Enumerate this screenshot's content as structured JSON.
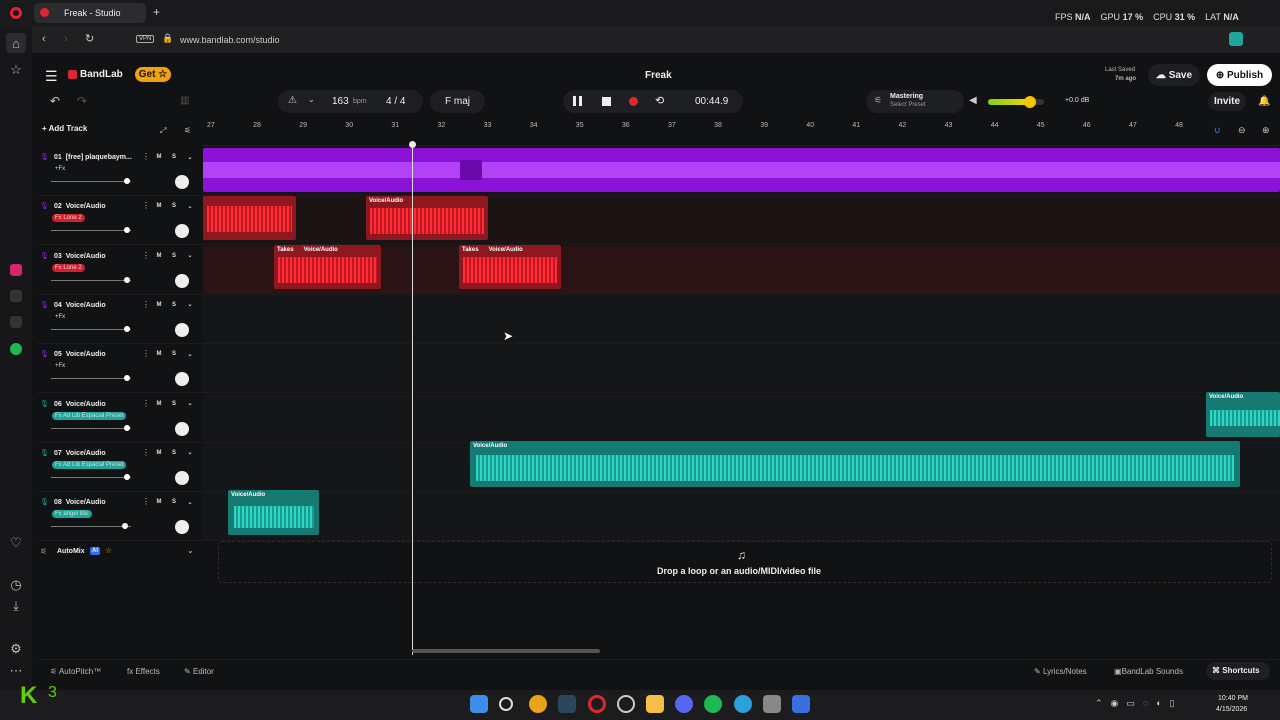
{
  "browser": {
    "tab_title": "Freak - Studio",
    "new_tab": "+",
    "url": "www.bandlab.com/studio",
    "vpn": "VPN",
    "stats": {
      "fps_label": "FPS",
      "fps": "N/A",
      "gpu_label": "GPU",
      "gpu": "17 %",
      "cpu_label": "CPU",
      "cpu": "31 %",
      "lat_label": "LAT",
      "lat": "N/A"
    }
  },
  "header": {
    "brand": "BandLab",
    "get_label": "Get",
    "project_title": "Freak",
    "last_saved_label": "Last Saved",
    "last_saved_time": "7m ago",
    "save_label": "Save",
    "publish_label": "Publish",
    "invite_label": "Invite"
  },
  "transport": {
    "bpm": "163",
    "bpm_unit": "bpm",
    "time_sig": "4 / 4",
    "key": "F maj",
    "time": "00:44.9",
    "mastering_label": "Mastering",
    "mastering_preset": "Select Preset",
    "gain": "+0.0 dB",
    "volume_level": 0.75
  },
  "add_track_label": "Add Track",
  "ruler": [
    "27",
    "28",
    "29",
    "30",
    "31",
    "32",
    "33",
    "34",
    "35",
    "36",
    "37",
    "38",
    "39",
    "40",
    "41",
    "42",
    "43",
    "44",
    "45",
    "46",
    "47",
    "48"
  ],
  "tracks": [
    {
      "num": "01",
      "name": "[free] plaquebaym...",
      "fx": "+Fx",
      "fx_style": "plain",
      "vol": 0.95
    },
    {
      "num": "02",
      "name": "Voice/Audio",
      "fx": "Fx Lone 2",
      "fx_style": "red",
      "vol": 0.95
    },
    {
      "num": "03",
      "name": "Voice/Audio",
      "fx": "Fx Lone 2",
      "fx_style": "red",
      "vol": 0.95
    },
    {
      "num": "04",
      "name": "Voice/Audio",
      "fx": "+Fx",
      "fx_style": "plain",
      "vol": 0.95
    },
    {
      "num": "05",
      "name": "Voice/Audio",
      "fx": "+Fx",
      "fx_style": "plain",
      "vol": 0.95
    },
    {
      "num": "06",
      "name": "Voice/Audio",
      "fx": "Fx Ad Lib Espacial Preset",
      "fx_style": "teal",
      "vol": 0.95
    },
    {
      "num": "07",
      "name": "Voice/Audio",
      "fx": "Fx Ad Lib Espacial Preset",
      "fx_style": "teal",
      "vol": 0.95
    },
    {
      "num": "08",
      "name": "Voice/Audio",
      "fx": "Fx angel libs",
      "fx_style": "teal",
      "vol": 0.92
    }
  ],
  "clip_labels": {
    "voice": "Voice/Audio",
    "takes": "Takes"
  },
  "automix": {
    "label": "AutoMix",
    "badge": "AI"
  },
  "drop_hint": "Drop a loop or an audio/MIDI/video file",
  "bottom": {
    "autopitch": "AutoPitch™",
    "effects": "Effects",
    "editor": "Editor",
    "lyrics": "Lyrics/Notes",
    "sounds": "BandLab Sounds",
    "shortcuts": "Shortcuts"
  },
  "taskbar": {
    "time": "10:40 PM",
    "date": "4/15/2026"
  },
  "overlay": {
    "logo": "K",
    "num": "3"
  },
  "colors": {
    "purple": "#9b1fe8",
    "red": "#d11f2c",
    "teal": "#1fa59a",
    "accent": "#f2a20d"
  }
}
